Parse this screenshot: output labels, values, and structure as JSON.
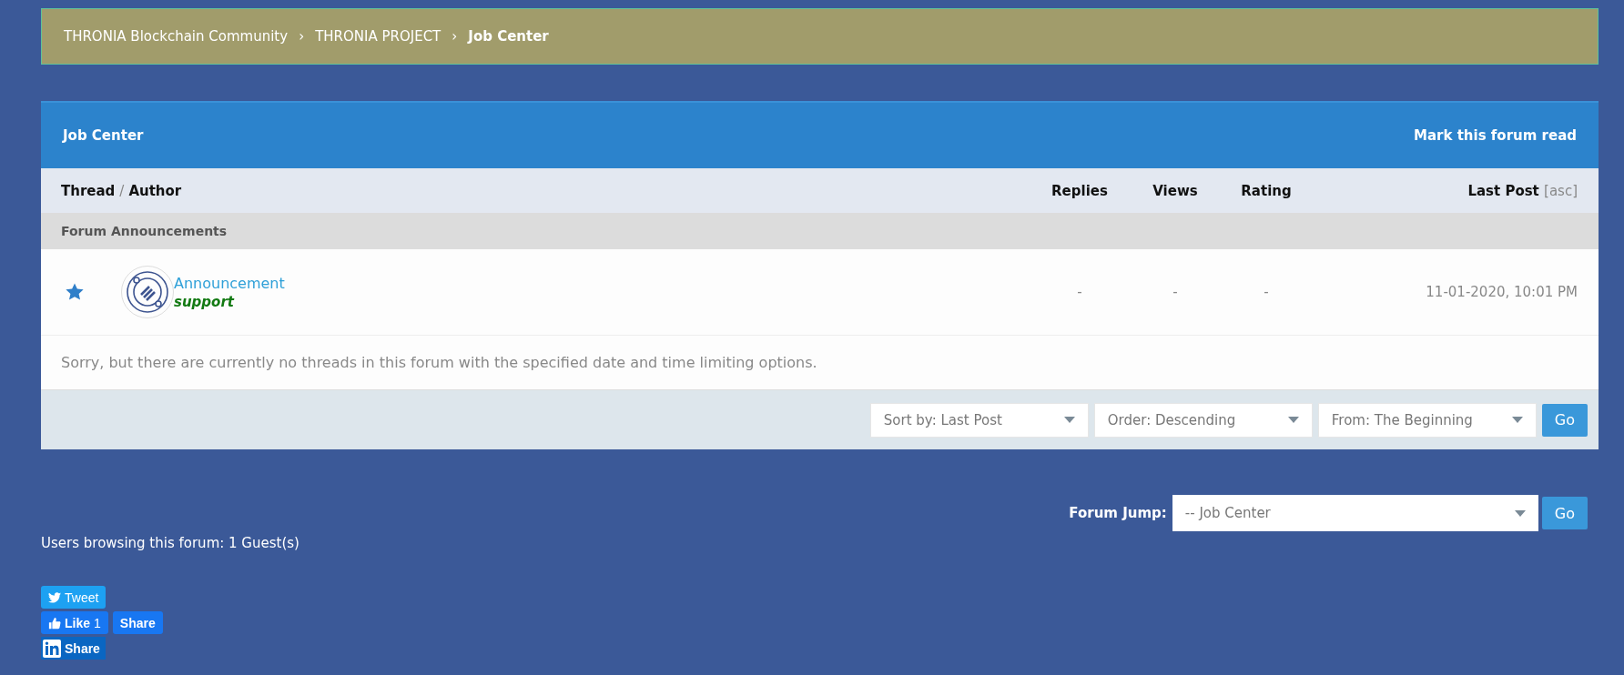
{
  "breadcrumb": [
    {
      "label": "THRONIA Blockchain Community",
      "current": false
    },
    {
      "label": "THRONIA PROJECT",
      "current": false
    },
    {
      "label": "Job Center",
      "current": true
    }
  ],
  "breadcrumb_separator": "›",
  "forum": {
    "title": "Job Center",
    "mark_read": "Mark this forum read",
    "columns": {
      "thread": "Thread",
      "slash": "/",
      "author": "Author",
      "replies": "Replies",
      "views": "Views",
      "rating": "Rating",
      "last_post": "Last Post",
      "sort": "[asc]"
    },
    "section": "Forum Announcements",
    "announcements": [
      {
        "title": "Announcement",
        "author": "support",
        "replies": "-",
        "views": "-",
        "rating": "-",
        "last_post": "11-01-2020, 10:01 PM"
      }
    ],
    "message": "Sorry, but there are currently no threads in this forum with the specified date and time limiting options.",
    "filters": [
      {
        "value": "Sort by: Last Post"
      },
      {
        "value": "Order: Descending"
      },
      {
        "value": "From: The Beginning"
      }
    ],
    "go": "Go"
  },
  "forum_jump": {
    "label": "Forum Jump:",
    "value": "-- Job Center",
    "go": "Go"
  },
  "users_browsing": "Users browsing this forum: 1 Guest(s)",
  "social": {
    "tweet": "Tweet",
    "like": "Like",
    "like_count": "1",
    "share": "Share",
    "linkedin_share": "Share"
  }
}
